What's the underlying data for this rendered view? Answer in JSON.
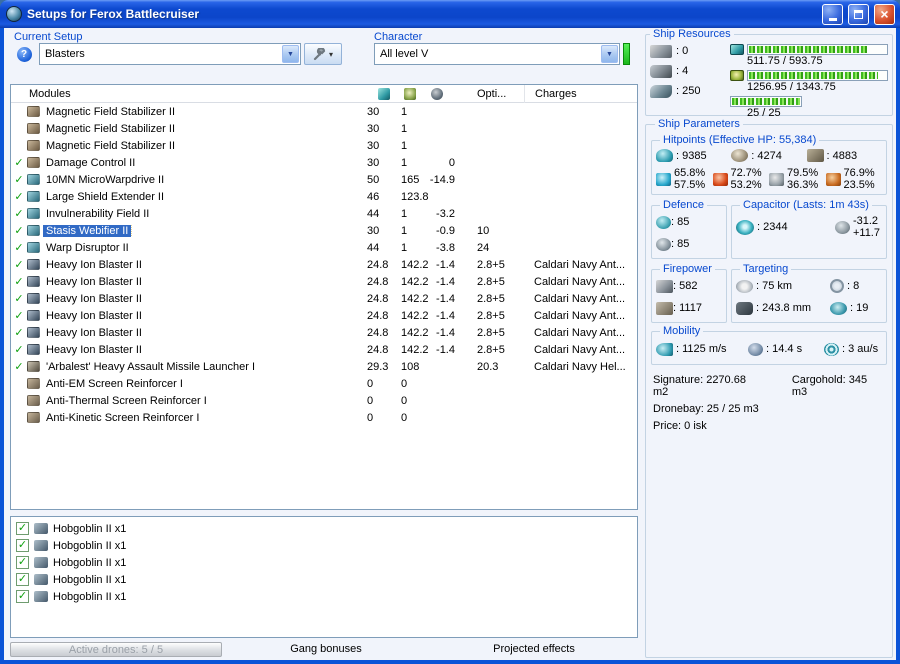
{
  "window": {
    "title": "Setups for Ferox Battlecruiser"
  },
  "setup": {
    "label": "Current Setup",
    "selected": "Blasters"
  },
  "character": {
    "label": "Character",
    "selected": "All level V"
  },
  "ship_resources": {
    "title": "Ship Resources",
    "turrets": "0",
    "launchers": "4",
    "drone_bandwidth": "250",
    "cpu_text": "511.75 / 593.75",
    "cpu_pct": 86,
    "powergrid_text": "1256.95 / 1343.75",
    "powergrid_pct": 94,
    "calibration_text": "25 / 25",
    "calibration_pct": 100
  },
  "modules_panel": {
    "title": "Modules",
    "opti_header": "Opti...",
    "charges_header": "Charges",
    "rows": [
      {
        "checked": false,
        "slot": "low",
        "name": "Magnetic Field Stabilizer II",
        "cpu": "30",
        "pg": "1",
        "cap": "",
        "opti": "",
        "charges": ""
      },
      {
        "checked": false,
        "slot": "low",
        "name": "Magnetic Field Stabilizer II",
        "cpu": "30",
        "pg": "1",
        "cap": "",
        "opti": "",
        "charges": ""
      },
      {
        "checked": false,
        "slot": "low",
        "name": "Magnetic Field Stabilizer II",
        "cpu": "30",
        "pg": "1",
        "cap": "",
        "opti": "",
        "charges": ""
      },
      {
        "checked": true,
        "slot": "low",
        "name": "Damage Control II",
        "cpu": "30",
        "pg": "1",
        "cap": "0",
        "opti": "",
        "charges": ""
      },
      {
        "checked": true,
        "slot": "mid",
        "name": "10MN MicroWarpdrive II",
        "cpu": "50",
        "pg": "165",
        "cap": "-14.9",
        "opti": "",
        "charges": ""
      },
      {
        "checked": true,
        "slot": "mid",
        "name": "Large Shield Extender II",
        "cpu": "46",
        "pg": "123.8",
        "cap": "",
        "opti": "",
        "charges": ""
      },
      {
        "checked": true,
        "slot": "mid",
        "name": "Invulnerability Field II",
        "cpu": "44",
        "pg": "1",
        "cap": "-3.2",
        "opti": "",
        "charges": ""
      },
      {
        "checked": true,
        "slot": "mid",
        "name": "Stasis Webifier II",
        "cpu": "30",
        "pg": "1",
        "cap": "-0.9",
        "opti": "10",
        "charges": "",
        "selected": true
      },
      {
        "checked": true,
        "slot": "mid",
        "name": "Warp Disruptor II",
        "cpu": "44",
        "pg": "1",
        "cap": "-3.8",
        "opti": "24",
        "charges": ""
      },
      {
        "checked": true,
        "slot": "gun",
        "name": "Heavy Ion Blaster II",
        "cpu": "24.8",
        "pg": "142.2",
        "cap": "-1.4",
        "opti": "2.8+5",
        "charges": "Caldari Navy Ant..."
      },
      {
        "checked": true,
        "slot": "gun",
        "name": "Heavy Ion Blaster II",
        "cpu": "24.8",
        "pg": "142.2",
        "cap": "-1.4",
        "opti": "2.8+5",
        "charges": "Caldari Navy Ant..."
      },
      {
        "checked": true,
        "slot": "gun",
        "name": "Heavy Ion Blaster II",
        "cpu": "24.8",
        "pg": "142.2",
        "cap": "-1.4",
        "opti": "2.8+5",
        "charges": "Caldari Navy Ant..."
      },
      {
        "checked": true,
        "slot": "gun",
        "name": "Heavy Ion Blaster II",
        "cpu": "24.8",
        "pg": "142.2",
        "cap": "-1.4",
        "opti": "2.8+5",
        "charges": "Caldari Navy Ant..."
      },
      {
        "checked": true,
        "slot": "gun",
        "name": "Heavy Ion Blaster II",
        "cpu": "24.8",
        "pg": "142.2",
        "cap": "-1.4",
        "opti": "2.8+5",
        "charges": "Caldari Navy Ant..."
      },
      {
        "checked": true,
        "slot": "gun",
        "name": "Heavy Ion Blaster II",
        "cpu": "24.8",
        "pg": "142.2",
        "cap": "-1.4",
        "opti": "2.8+5",
        "charges": "Caldari Navy Ant..."
      },
      {
        "checked": true,
        "slot": "launcher",
        "name": "'Arbalest' Heavy Assault Missile Launcher I",
        "cpu": "29.3",
        "pg": "108",
        "cap": "",
        "opti": "20.3",
        "charges": "Caldari Navy Hel..."
      },
      {
        "checked": false,
        "slot": "rig",
        "name": "Anti-EM Screen Reinforcer I",
        "cpu": "0",
        "pg": "0",
        "cap": "",
        "opti": "",
        "charges": ""
      },
      {
        "checked": false,
        "slot": "rig",
        "name": "Anti-Thermal Screen Reinforcer I",
        "cpu": "0",
        "pg": "0",
        "cap": "",
        "opti": "",
        "charges": ""
      },
      {
        "checked": false,
        "slot": "rig",
        "name": "Anti-Kinetic Screen Reinforcer I",
        "cpu": "0",
        "pg": "0",
        "cap": "",
        "opti": "",
        "charges": ""
      }
    ]
  },
  "drones": {
    "rows": [
      {
        "label": "Hobgoblin II x1"
      },
      {
        "label": "Hobgoblin II x1"
      },
      {
        "label": "Hobgoblin II x1"
      },
      {
        "label": "Hobgoblin II x1"
      },
      {
        "label": "Hobgoblin II x1"
      }
    ]
  },
  "bottom_bar": {
    "active_drones": "Active drones: 5 / 5",
    "gang_bonuses": "Gang bonuses",
    "projected_effects": "Projected effects"
  },
  "ship_parameters": {
    "title": "Ship Parameters",
    "hitpoints": {
      "title": "Hitpoints (Effective HP: 55,384)",
      "shield": "9385",
      "armor": "4274",
      "structure": "4883",
      "resists": [
        {
          "type": "em",
          "top": "65.8%",
          "bottom": "57.5%"
        },
        {
          "type": "thermal",
          "top": "72.7%",
          "bottom": "53.2%"
        },
        {
          "type": "kinetic",
          "top": "79.5%",
          "bottom": "36.3%"
        },
        {
          "type": "explosive",
          "top": "76.9%",
          "bottom": "23.5%"
        }
      ]
    },
    "defence": {
      "title": "Defence",
      "shield_recharge": "85",
      "passive": "85"
    },
    "capacitor": {
      "title": "Capacitor (Lasts: 1m 43s)",
      "amount": "2344",
      "drain": "-31.2",
      "recharge": "+11.7"
    },
    "firepower": {
      "title": "Firepower",
      "dps": "582",
      "volley": "1117"
    },
    "targeting": {
      "title": "Targeting",
      "range": "75 km",
      "max_targets": "8",
      "scan_resolution": "243.8 mm",
      "sensor_strength": "19"
    },
    "mobility": {
      "title": "Mobility",
      "speed": "1125 m/s",
      "align_time": "14.4 s",
      "warp_speed": "3 au/s"
    },
    "signature": "Signature: 2270.68 m2",
    "cargohold": "Cargohold: 345 m3",
    "dronebay": "Dronebay: 25 / 25 m3",
    "price": "Price: 0 isk"
  }
}
